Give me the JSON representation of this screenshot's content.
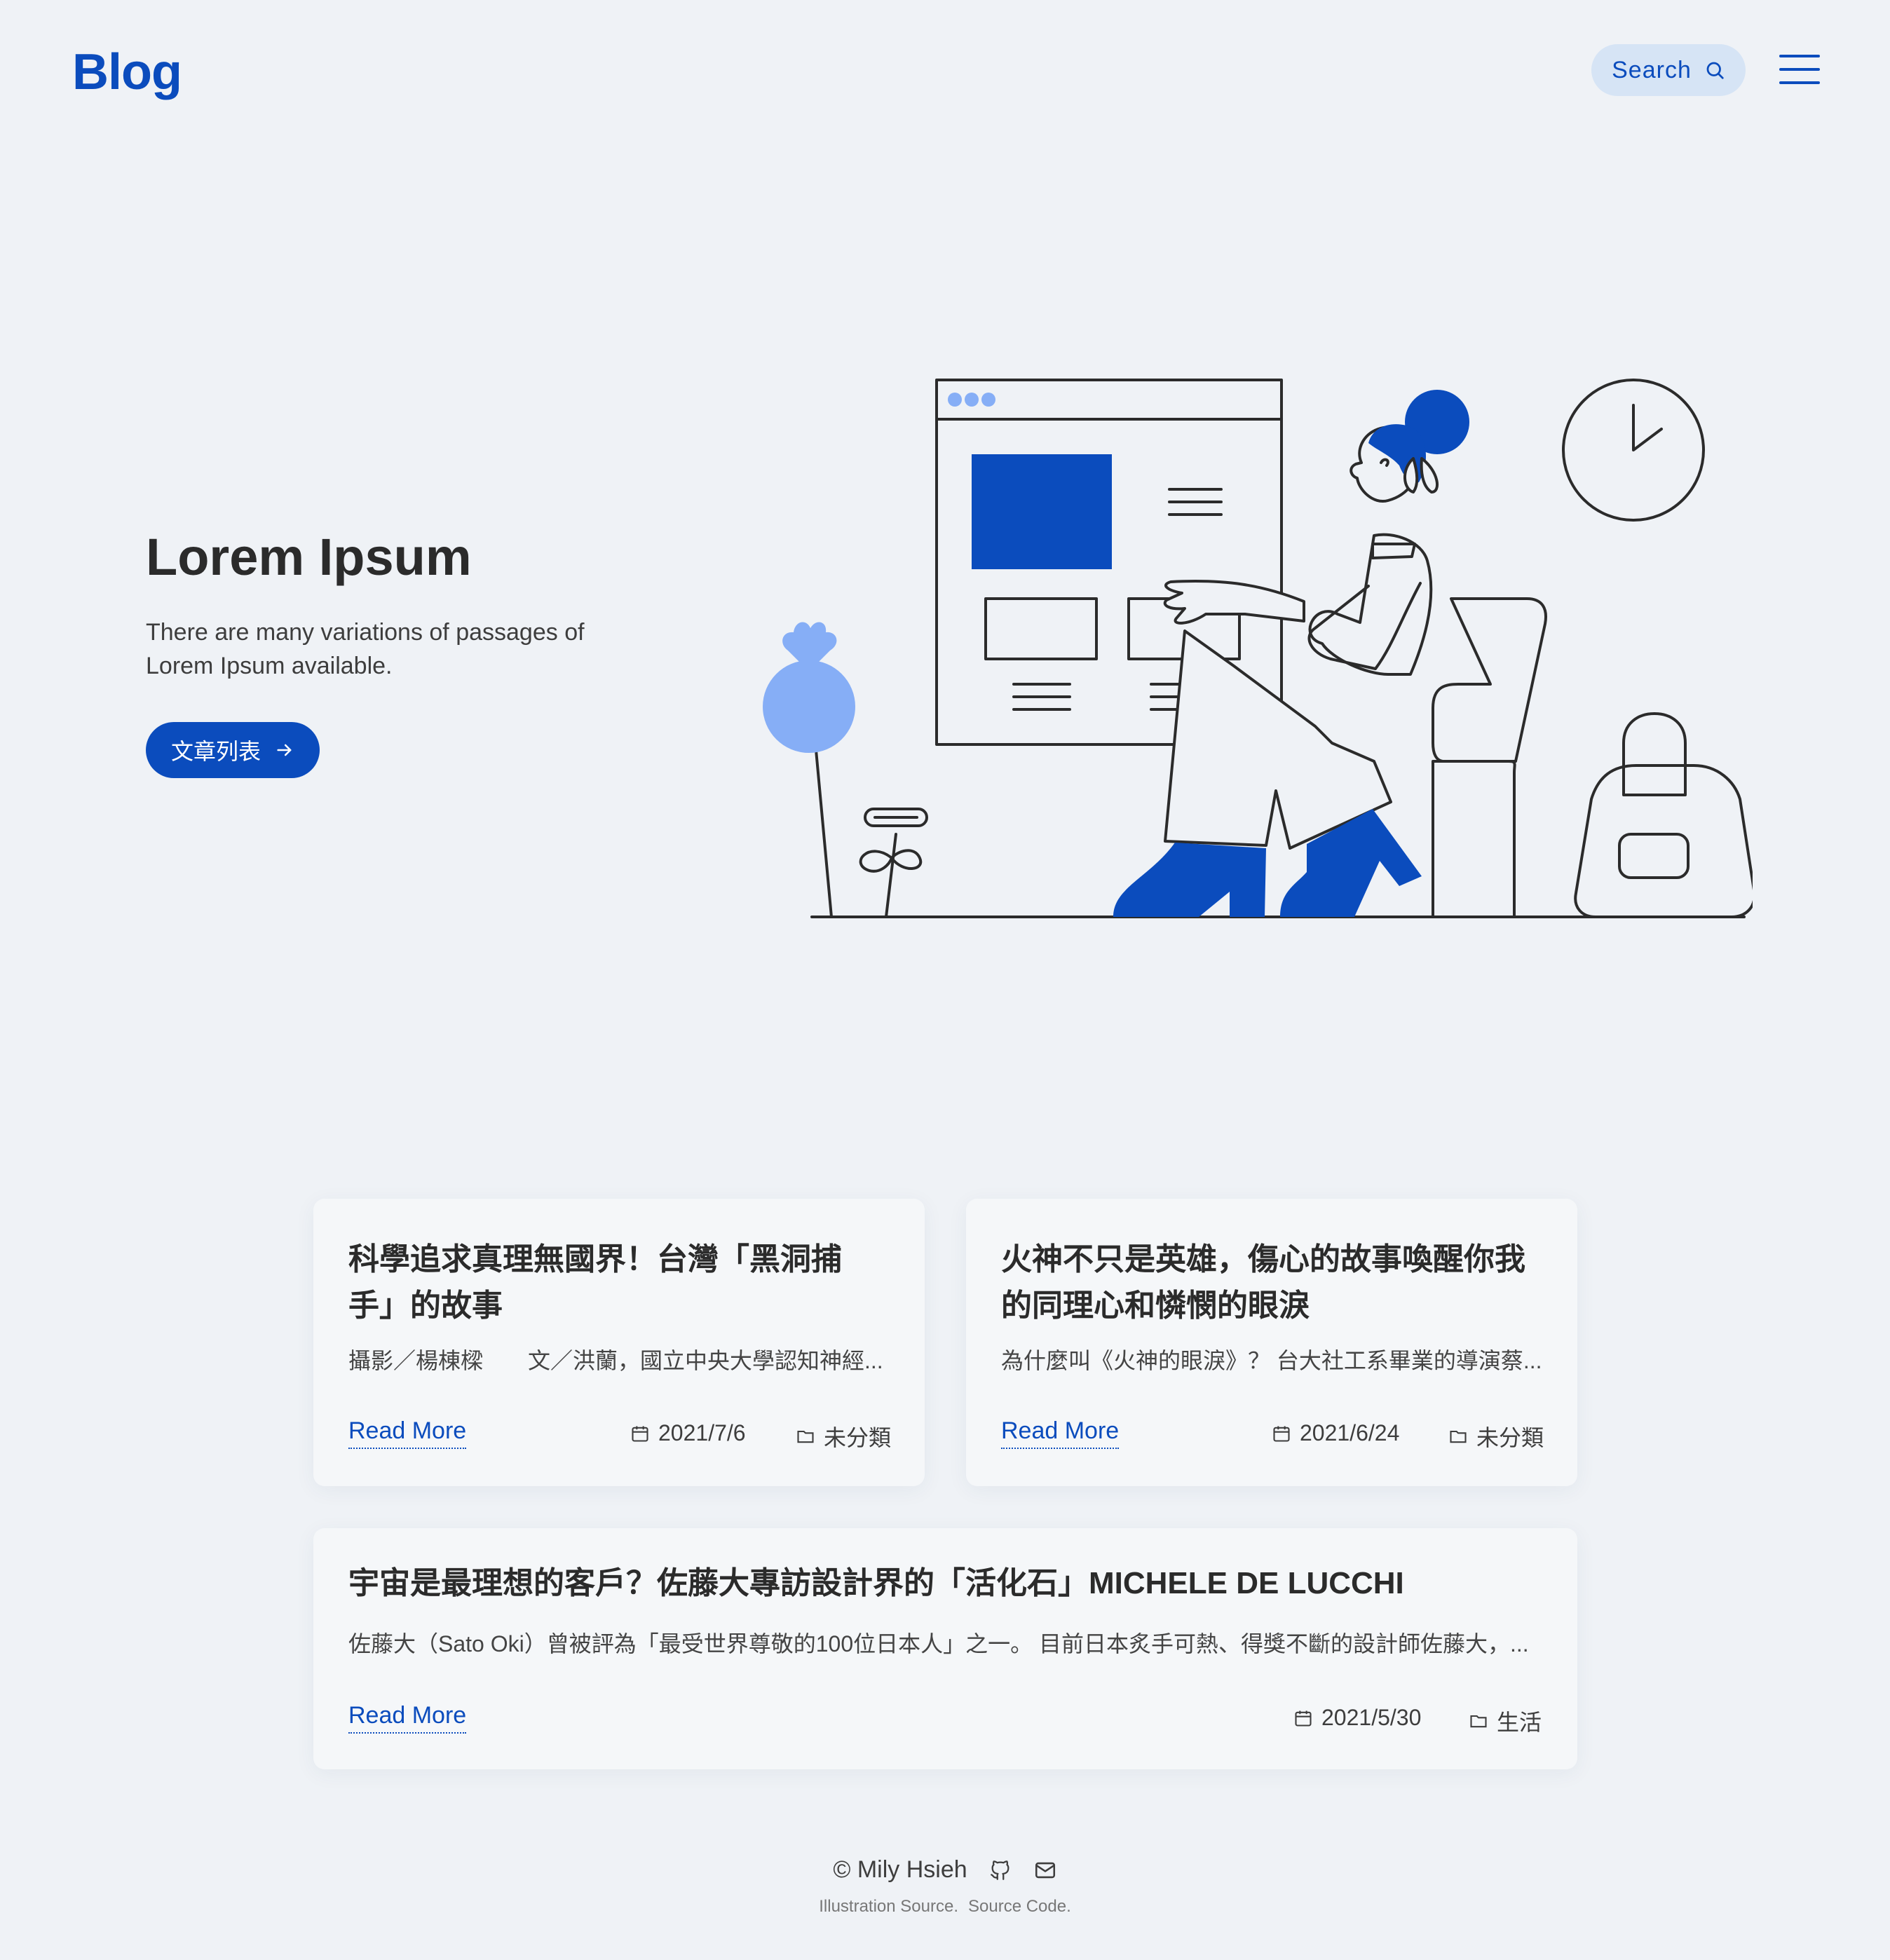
{
  "header": {
    "brand": "Blog",
    "search_label": "Search",
    "accent_color": "#0b4cbd"
  },
  "hero": {
    "title": "Lorem Ipsum",
    "subtitle": "There are many variations of passages of Lorem Ipsum available.",
    "button_label": "文章列表"
  },
  "posts": [
    {
      "title": "科學追求真理無國界！台灣「黑洞捕手」的故事",
      "excerpt": "攝影／楊棟樑　　文／洪蘭，國立中央大學認知神經...",
      "read_more": "Read More",
      "date": "2021/7/6",
      "category": "未分類"
    },
    {
      "title": "火神不只是英雄，傷心的故事喚醒你我的同理心和憐憫的眼淚",
      "excerpt": "為什麼叫《火神的眼淚》？ 台大社工系畢業的導演蔡...",
      "read_more": "Read More",
      "date": "2021/6/24",
      "category": "未分類"
    },
    {
      "title": "宇宙是最理想的客戶？佐藤大專訪設計界的「活化石」MICHELE DE LUCCHI",
      "excerpt": "佐藤大（Sato Oki）曾被評為「最受世界尊敬的100位日本人」之一。 目前日本炙手可熱、得獎不斷的設計師佐藤大，...",
      "read_more": "Read More",
      "date": "2021/5/30",
      "category": "生活"
    }
  ],
  "footer": {
    "copyright": "© Mily Hsieh",
    "illustration_link": "Illustration Source.",
    "source_link": "Source Code."
  }
}
